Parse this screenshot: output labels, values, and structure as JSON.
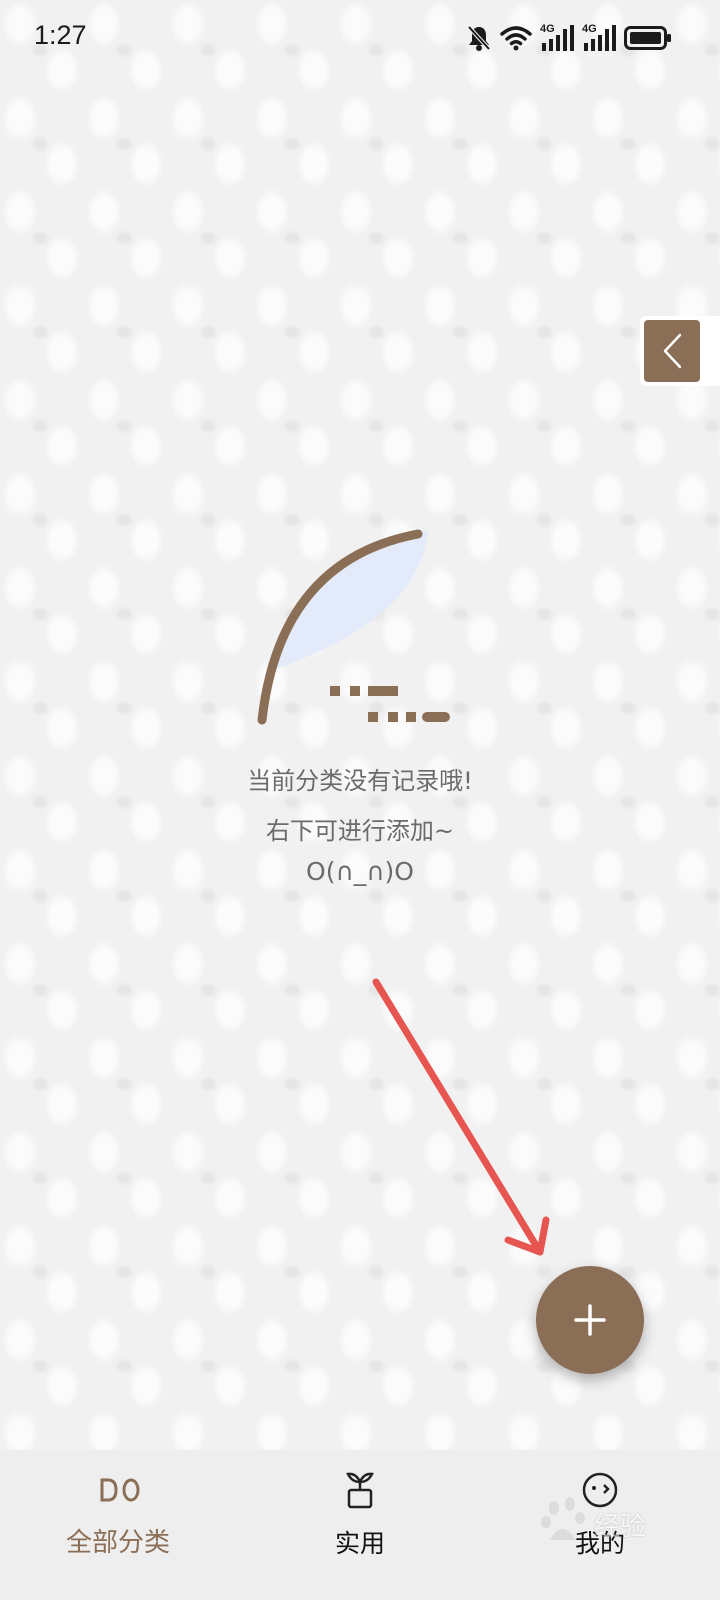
{
  "status_bar": {
    "time": "1:27",
    "icons": [
      "bell-off-icon",
      "wifi-icon",
      "signal-4g-icon",
      "signal-4g-icon",
      "battery-icon"
    ],
    "network_label_1": "4G",
    "network_label_2": "4G"
  },
  "empty_state": {
    "line1": "当前分类没有记录哦!",
    "line2": "右下可进行添加~",
    "line3": "O(∩_∩)O"
  },
  "fab": {
    "icon": "plus-icon"
  },
  "side_tab": {
    "icon": "chevron-left-icon"
  },
  "bottom_nav": {
    "items": [
      {
        "label": "全部分类",
        "icon": "do-logo-icon",
        "active": true
      },
      {
        "label": "实用",
        "icon": "sprout-icon",
        "active": false
      },
      {
        "label": "我的",
        "icon": "face-icon",
        "active": false
      }
    ]
  },
  "watermark": {
    "text": "经验"
  },
  "colors": {
    "accent": "#8b6e56",
    "arrow": "#e65550",
    "text_muted": "#6b6b6b"
  }
}
